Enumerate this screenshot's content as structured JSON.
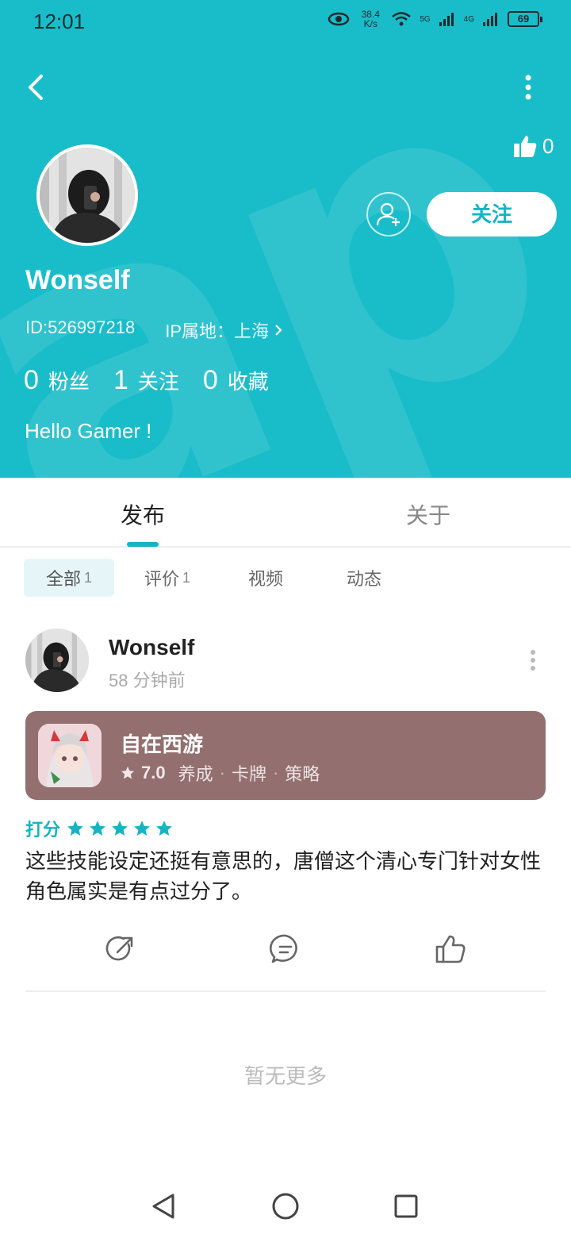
{
  "status_bar": {
    "time": "12:01",
    "net_speed": "38.4\nK/s",
    "signal1": "5G",
    "signal2": "4G",
    "battery": "69"
  },
  "profile": {
    "likes": "0",
    "follow_button": "关注",
    "username": "Wonself",
    "id": "ID:526997218",
    "ip_location": "IP属地：上海",
    "stats": [
      {
        "value": "0",
        "label": "粉丝"
      },
      {
        "value": "1",
        "label": "关注"
      },
      {
        "value": "0",
        "label": "收藏"
      }
    ],
    "bio": "Hello Gamer !"
  },
  "tabs": [
    {
      "label": "发布",
      "active": true
    },
    {
      "label": "关于",
      "active": false
    }
  ],
  "filters": [
    {
      "label": "全部",
      "count": "1",
      "active": true
    },
    {
      "label": "评价",
      "count": "1",
      "active": false
    },
    {
      "label": "视频",
      "count": "",
      "active": false
    },
    {
      "label": "动态",
      "count": "",
      "active": false
    }
  ],
  "post": {
    "username": "Wonself",
    "time": "58 分钟前",
    "game": {
      "title": "自在西游",
      "rating": "7.0",
      "tags": [
        "养成",
        "卡牌",
        "策略"
      ]
    },
    "rating_label": "打分",
    "stars": 5,
    "content": "这些技能设定还挺有意思的，唐僧这个清心专门针对女性角色属实是有点过分了。"
  },
  "footer": {
    "no_more": "暂无更多"
  },
  "colors": {
    "accent": "#19bdc9",
    "card": "#946f70"
  },
  "icons": [
    "back-icon",
    "more-icon",
    "thumb-up-icon",
    "add-friend-icon",
    "chevron-right-icon",
    "star-icon",
    "share-icon",
    "comment-icon",
    "like-icon",
    "nav-back-icon",
    "nav-home-icon",
    "nav-recent-icon"
  ]
}
